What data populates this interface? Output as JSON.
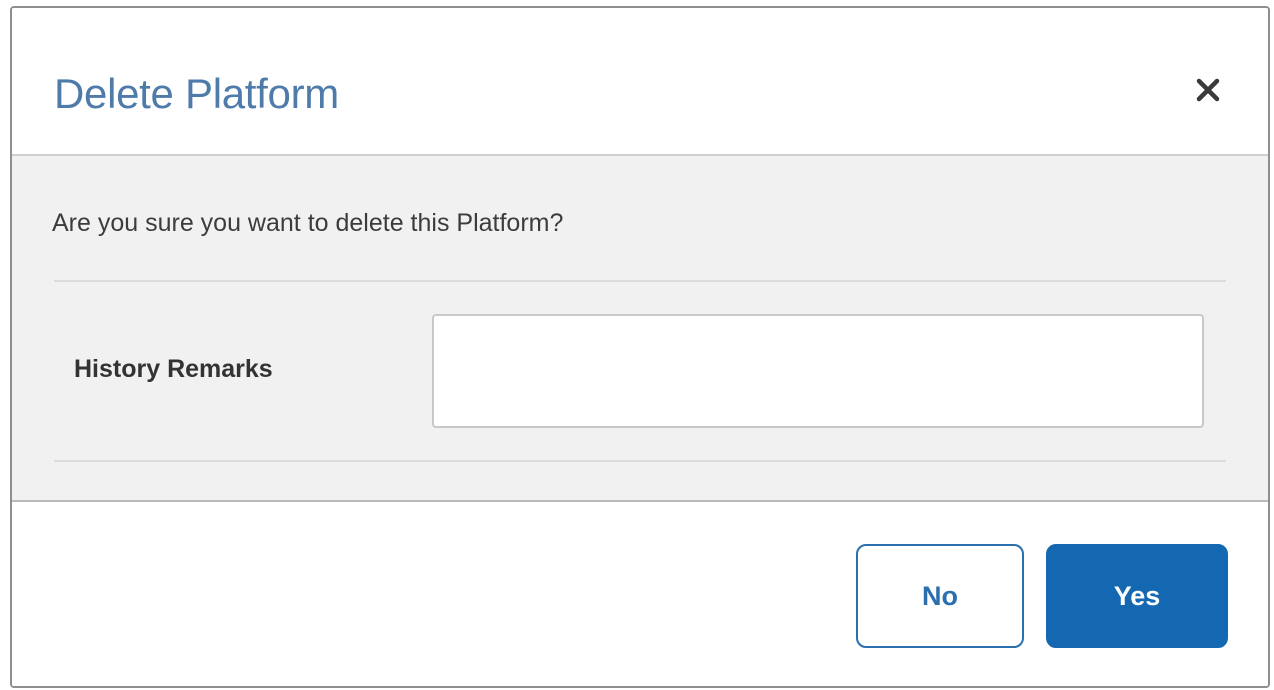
{
  "dialog": {
    "title": "Delete Platform",
    "close_icon": "close-icon",
    "message": "Are you sure you want to delete this Platform?",
    "remarks": {
      "label": "History Remarks",
      "value": "",
      "placeholder": ""
    },
    "buttons": {
      "no_label": "No",
      "yes_label": "Yes"
    }
  },
  "colors": {
    "title": "#4f7bab",
    "primary": "#1468b2",
    "body_background": "#f1f1f1"
  }
}
